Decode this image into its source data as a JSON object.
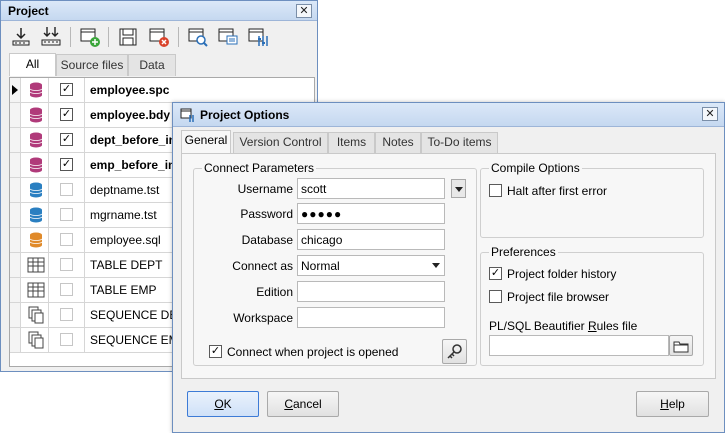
{
  "project_window": {
    "title": "Project",
    "close": "✕",
    "tabs": [
      "All",
      "Source files",
      "Data"
    ],
    "rows": [
      {
        "name": "employee.spc",
        "bold": true,
        "checked": true,
        "icon": "package-spec-icon",
        "color": "#b03a7a"
      },
      {
        "name": "employee.bdy",
        "bold": true,
        "checked": true,
        "icon": "package-body-icon",
        "color": "#b03a7a"
      },
      {
        "name": "dept_before_ins",
        "bold": true,
        "checked": true,
        "icon": "trigger-icon",
        "color": "#b03a7a"
      },
      {
        "name": "emp_before_ins",
        "bold": true,
        "checked": true,
        "icon": "trigger-icon",
        "color": "#b03a7a"
      },
      {
        "name": "deptname.tst",
        "bold": false,
        "checked": false,
        "icon": "test-script-icon",
        "color": "#2a7fc1"
      },
      {
        "name": "mgrname.tst",
        "bold": false,
        "checked": false,
        "icon": "test-script-icon",
        "color": "#2a7fc1"
      },
      {
        "name": "employee.sql",
        "bold": false,
        "checked": false,
        "icon": "sql-file-icon",
        "color": "#e08a2a"
      },
      {
        "name": "TABLE DEPT",
        "bold": false,
        "checked": false,
        "icon": "table-icon",
        "color": "#444444"
      },
      {
        "name": "TABLE EMP",
        "bold": false,
        "checked": false,
        "icon": "table-icon",
        "color": "#444444"
      },
      {
        "name": "SEQUENCE DEPTNO",
        "bold": false,
        "checked": false,
        "icon": "sequence-icon",
        "color": "#444444"
      },
      {
        "name": "SEQUENCE EMPNO",
        "bold": false,
        "checked": false,
        "icon": "sequence-icon",
        "color": "#444444"
      }
    ]
  },
  "dialog": {
    "title": "Project Options",
    "close": "✕",
    "tabs": [
      "General",
      "Version Control",
      "Items",
      "Notes",
      "To-Do items"
    ],
    "connect": {
      "caption": "Connect Parameters",
      "username_label": "Username",
      "username": "scott",
      "password_label": "Password",
      "password": "●●●●●",
      "database_label": "Database",
      "database": "chicago",
      "connect_as_label": "Connect as",
      "connect_as": "Normal",
      "edition_label": "Edition",
      "edition": "",
      "workspace_label": "Workspace",
      "workspace": "",
      "connect_on_open": "Connect when project is opened"
    },
    "compile": {
      "caption": "Compile Options",
      "halt": "Halt after first error"
    },
    "preferences": {
      "caption": "Preferences",
      "folder_history": "Project folder history",
      "file_browser": "Project file browser",
      "beautifier_prefix": "PL/SQL Beautifier ",
      "beautifier_accel": "R",
      "beautifier_suffix": "ules file",
      "beautifier_value": ""
    },
    "buttons": {
      "ok_accel": "O",
      "ok_rest": "K",
      "cancel_accel": "C",
      "cancel_rest": "ancel",
      "help_accel": "H",
      "help_rest": "elp"
    },
    "check": "✓"
  }
}
